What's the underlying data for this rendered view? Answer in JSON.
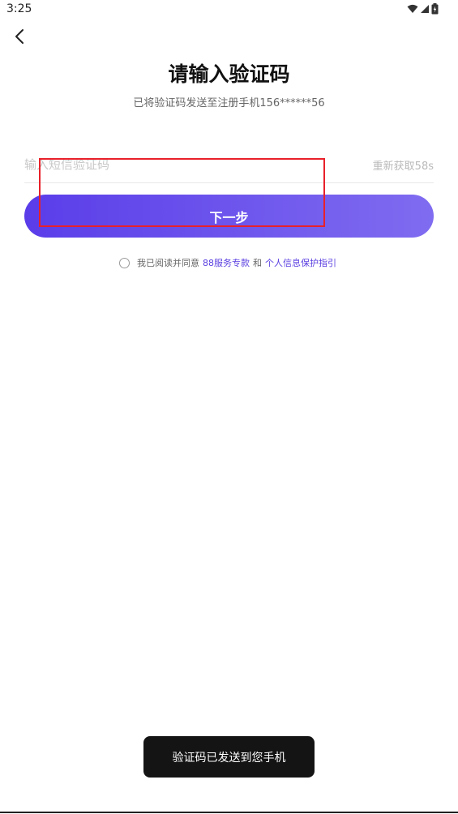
{
  "status_bar": {
    "time": "3:25",
    "icons": [
      "wifi-icon",
      "signal-icon",
      "battery-charging-icon"
    ]
  },
  "header": {
    "back_icon": "chevron-left-icon",
    "title": "请输入验证码",
    "subtitle": "已将验证码发送至注册手机156******56"
  },
  "form": {
    "code_input": {
      "placeholder": "输入短信验证码",
      "value": ""
    },
    "resend_label": "重新获取58s",
    "next_button_label": "下一步"
  },
  "agreement": {
    "prefix": "我已阅读并同意",
    "link_service": "88服务专款",
    "conjunction": "和",
    "link_privacy": "个人信息保护指引",
    "checked": false
  },
  "toast": {
    "text": "验证码已发送到您手机"
  },
  "colors": {
    "accent_start": "#5a3de9",
    "accent_end": "#7f6cf0",
    "link": "#5b3fe0",
    "highlight": "#e8212a"
  }
}
